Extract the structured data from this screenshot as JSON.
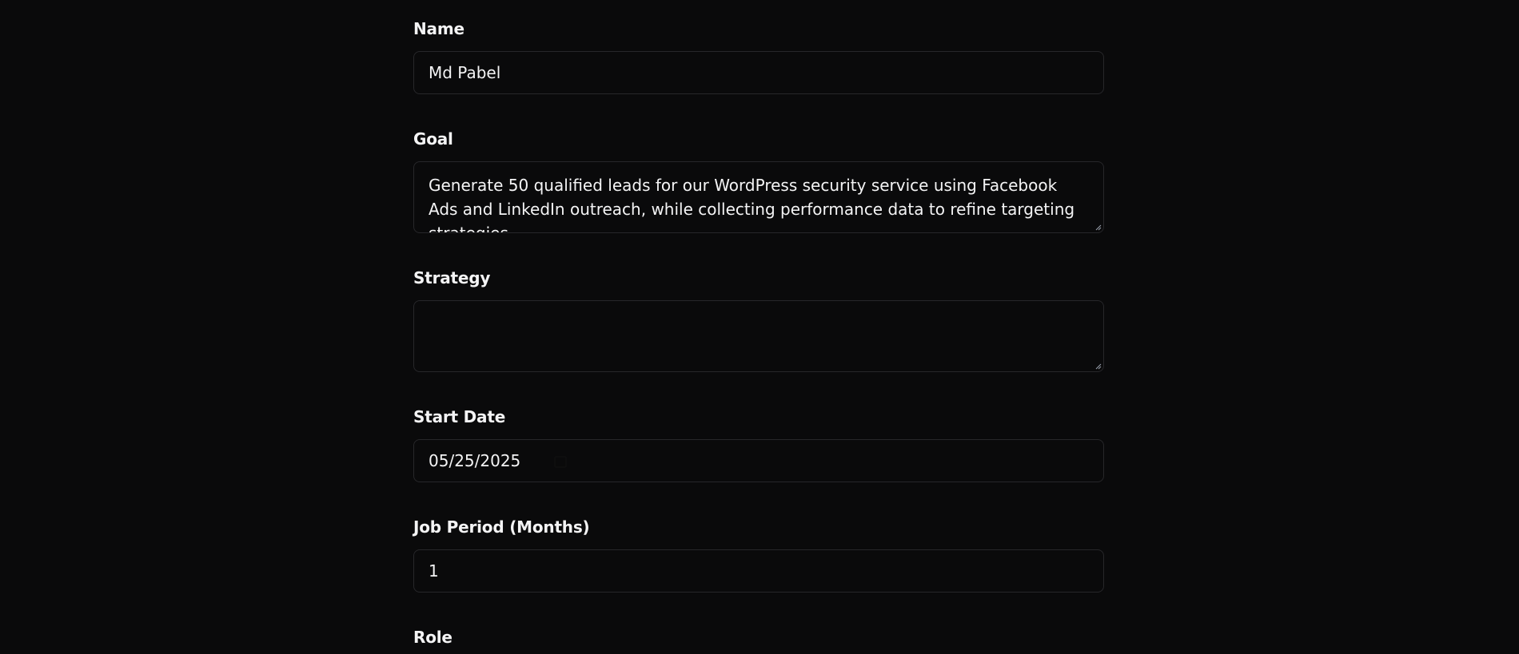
{
  "form": {
    "name": {
      "label": "Name",
      "value": "Md Pabel"
    },
    "goal": {
      "label": "Goal",
      "value": "Generate 50 qualified leads for our WordPress security service using Facebook Ads and LinkedIn outreach, while collecting performance data to refine targeting strategies."
    },
    "strategy": {
      "label": "Strategy",
      "value": ""
    },
    "start_date": {
      "label": "Start Date",
      "value": "05/25/2025",
      "icon": "calendar-icon"
    },
    "job_period": {
      "label": "Job Period (Months)",
      "value": "1"
    },
    "role": {
      "label": "Role"
    }
  },
  "colors": {
    "background": "#0a0a0b",
    "border": "#27272a",
    "text": "#f4f4f5"
  }
}
